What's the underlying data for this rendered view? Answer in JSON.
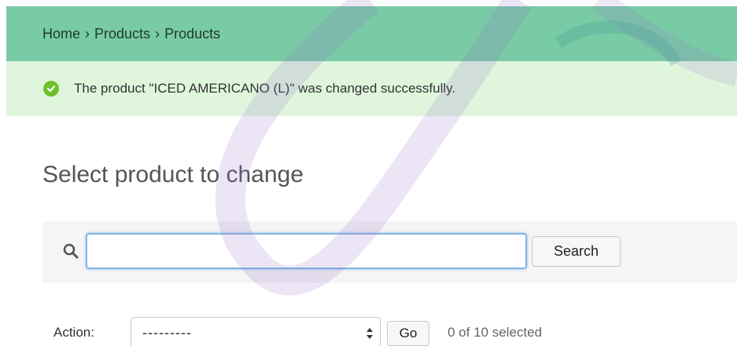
{
  "breadcrumbs": {
    "home": "Home",
    "separator": "›",
    "app": "Products",
    "model": "Products"
  },
  "message": {
    "icon": "success-check-icon",
    "text": "The product \"ICED AMERICANO (L)\" was changed successfully."
  },
  "page": {
    "title": "Select product to change"
  },
  "search": {
    "icon": "search-icon",
    "value": "",
    "placeholder": "",
    "button_label": "Search"
  },
  "actions": {
    "label": "Action:",
    "selected_option": "---------",
    "go_label": "Go",
    "selection_count": "0 of 10 selected"
  },
  "colors": {
    "breadcrumb_bg": "#79cba5",
    "message_bg": "#dff6dd",
    "success_icon": "#70bf2b",
    "focus_border": "#7fb6e6"
  }
}
